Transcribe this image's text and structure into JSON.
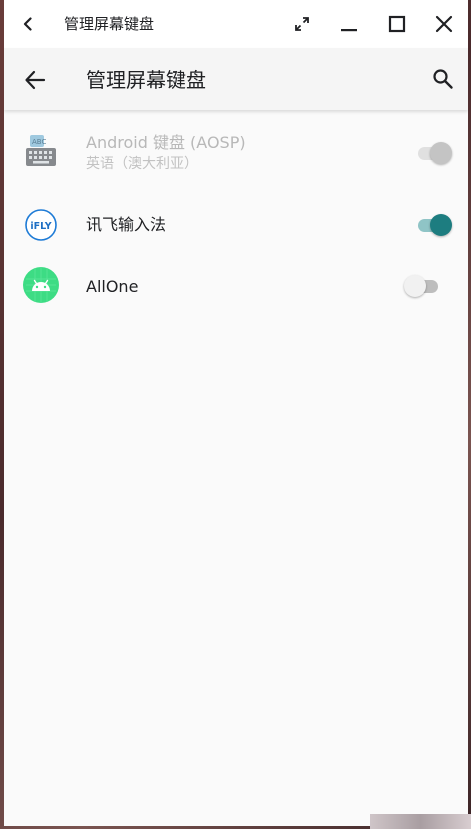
{
  "window": {
    "title": "管理屏幕键盘"
  },
  "appbar": {
    "title": "管理屏幕键盘"
  },
  "keyboards": [
    {
      "name": "Android 键盘 (AOSP)",
      "subtitle": "英语（澳大利亚）",
      "enabled": true,
      "disabled_row": true,
      "icon": "aosp-keyboard-icon"
    },
    {
      "name": "讯飞输入法",
      "subtitle": "",
      "enabled": true,
      "disabled_row": false,
      "icon": "iflytek-icon",
      "icon_text": "iFLY"
    },
    {
      "name": "AllOne",
      "subtitle": "",
      "enabled": false,
      "disabled_row": false,
      "icon": "android-robot-icon"
    }
  ],
  "colors": {
    "accent": "#1d7d80",
    "accent_track": "#8fc4c6",
    "off_thumb": "#f1f1f1",
    "off_track": "#bdbdbd",
    "disabled_thumb": "#c4c4c4",
    "disabled_track": "#e0e0e0",
    "allone_green": "#3ddc84"
  }
}
